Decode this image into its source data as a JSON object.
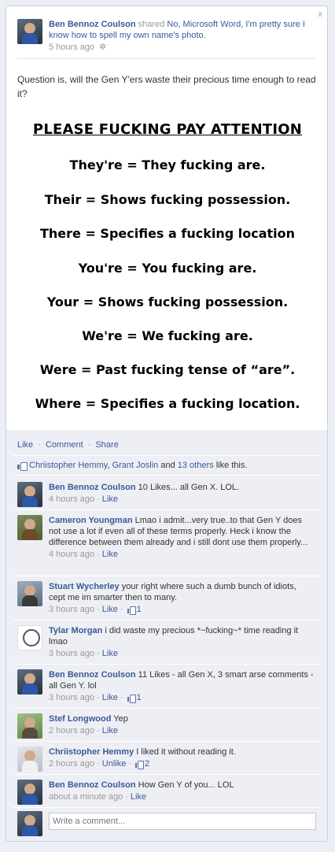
{
  "post": {
    "author": "Ben Bennoz Coulson",
    "shared_text": "shared",
    "photo_owner_text": "No, Microsoft Word, I'm pretty sure I know how to spell my own name's photo.",
    "timestamp": "5 hours ago",
    "close_glyph": "x",
    "question": "Question is, will the Gen Y'ers waste their precious time enough to read it?"
  },
  "photo": {
    "title": "PLEASE FUCKING PAY ATTENTION",
    "rules": [
      "They're  = They fucking are.",
      "Their = Shows fucking possession.",
      "There = Specifies a fucking location",
      "You're = You fucking are.",
      "Your = Shows fucking possession.",
      "We're = We fucking are.",
      "Were = Past fucking tense of “are”.",
      "Where = Specifies a fucking location."
    ]
  },
  "actions": {
    "like": "Like",
    "comment": "Comment",
    "share": "Share",
    "sep": "·"
  },
  "likes": {
    "liker1": "Chriistopher Hemmy",
    "sep": ",",
    "liker2": "Grant Joslin",
    "and": "and",
    "others": "13 others",
    "suffix": "like this."
  },
  "comments": [
    {
      "name": "Ben Bennoz Coulson",
      "text": "10 Likes... all Gen X. LOL.",
      "time": "4 hours ago",
      "action": "Like",
      "likes": ""
    },
    {
      "name": "Cameron Youngman",
      "text": "Lmao i admit...very true..to that Gen Y does not use a lot if even all of these terms properly. Heck i know the difference between them already and i still dont use them properly...",
      "time": "4 hours ago",
      "action": "Like",
      "likes": ""
    },
    {
      "name": "Stuart Wycherley",
      "text": "your right where such a dumb bunch of idiots, cept me im smarter then to many.",
      "time": "3 hours ago",
      "action": "Like",
      "likes": "1"
    },
    {
      "name": "Tylar Morgan",
      "text": "i did waste my precious *~fucking~* time reading it lmao",
      "time": "3 hours ago",
      "action": "Like",
      "likes": ""
    },
    {
      "name": "Ben Bennoz Coulson",
      "text": "11 Likes - all Gen X, 3 smart arse comments - all Gen Y. lol",
      "time": "3 hours ago",
      "action": "Like",
      "likes": "1"
    },
    {
      "name": "Stef Longwood",
      "text": "Yep",
      "time": "2 hours ago",
      "action": "Like",
      "likes": ""
    },
    {
      "name": "Chriistopher Hemmy",
      "text": "I liked it without reading it.",
      "time": "2 hours ago",
      "action": "Unlike",
      "likes": "2"
    },
    {
      "name": "Ben Bennoz Coulson",
      "text": "How Gen Y of you... LOL",
      "time": "about a minute ago",
      "action": "Like",
      "likes": ""
    }
  ],
  "write_comment": {
    "placeholder": "Write a comment..."
  }
}
